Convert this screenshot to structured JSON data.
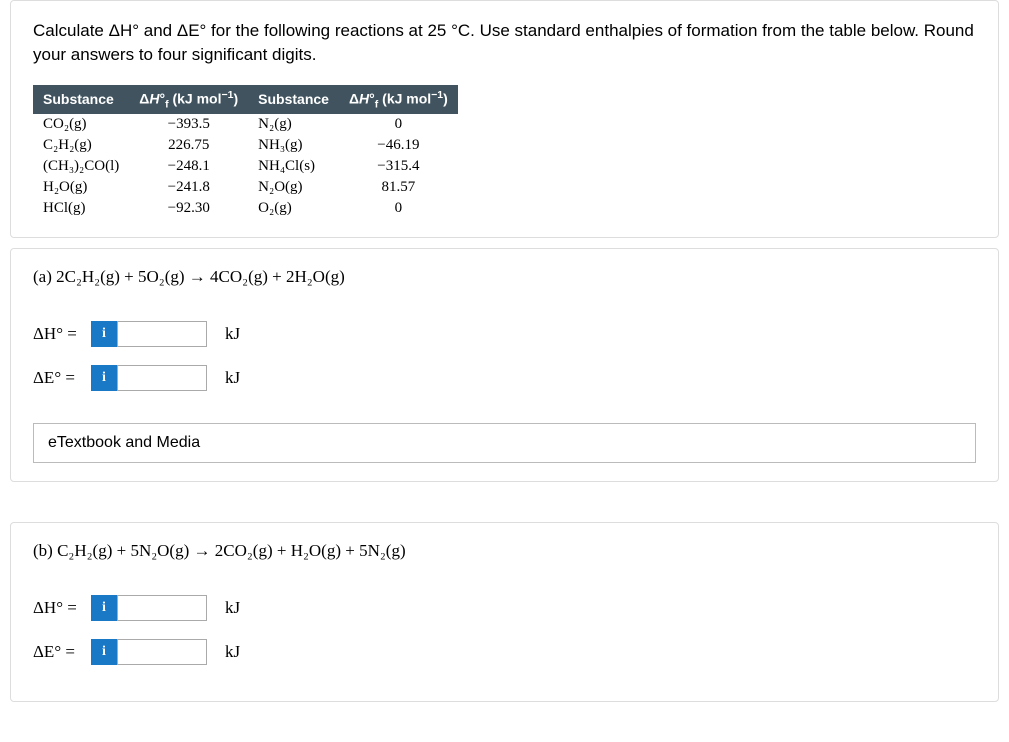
{
  "intro": "Calculate ΔH° and ΔE° for the following reactions at 25 °C. Use standard enthalpies of formation from the table below. Round your answers to four significant digits.",
  "tHeaders": {
    "substance": "Substance",
    "dhf": "ΔH°f (kJ mol⁻¹)"
  },
  "table": {
    "left": [
      {
        "f": "CO₂(g)",
        "v": "−393.5"
      },
      {
        "f": "C₂H₂(g)",
        "v": "226.75"
      },
      {
        "f": "(CH₃)₂CO(l)",
        "v": "−248.1"
      },
      {
        "f": "H₂O(g)",
        "v": "−241.8"
      },
      {
        "f": "HCl(g)",
        "v": "−92.30"
      }
    ],
    "right": [
      {
        "f": "N₂(g)",
        "v": "0"
      },
      {
        "f": "NH₃(g)",
        "v": "−46.19"
      },
      {
        "f": "NH₄Cl(s)",
        "v": "−315.4"
      },
      {
        "f": "N₂O(g)",
        "v": "81.57"
      },
      {
        "f": "O₂(g)",
        "v": "0"
      }
    ]
  },
  "partA": {
    "eqn": "(a) 2C₂H₂(g) + 5O₂(g) → 4CO₂(g) + 2H₂O(g)",
    "dHLabel": "ΔH° =",
    "dELabel": "ΔE° =",
    "unit": "kJ",
    "info": "i"
  },
  "etextbook": "eTextbook and Media",
  "partB": {
    "eqn": "(b) C₂H₂(g) + 5N₂O(g) → 2CO₂(g) + H₂O(g) + 5N₂(g)",
    "dHLabel": "ΔH° =",
    "dELabel": "ΔE° =",
    "unit": "kJ",
    "info": "i"
  }
}
